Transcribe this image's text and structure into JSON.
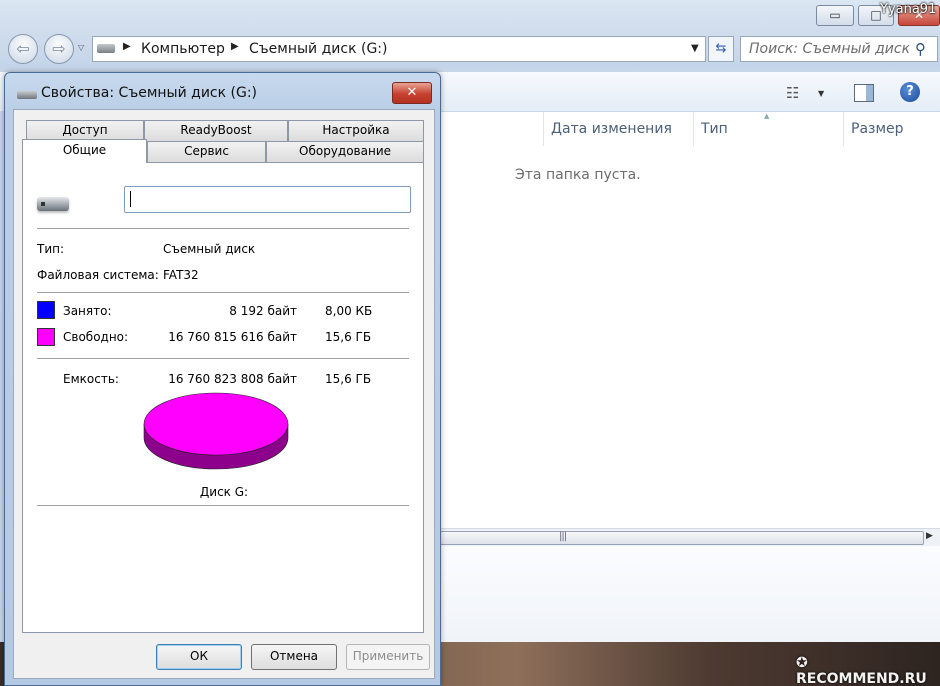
{
  "window": {
    "user_label": "Yyana91",
    "minimize_glyph": "▭",
    "maximize_glyph": "□",
    "close_glyph": "✕"
  },
  "nav": {
    "back_icon": "back-arrow-icon",
    "forward_icon": "forward-arrow-icon",
    "back_glyph": "⇦",
    "forward_glyph": "⇨",
    "recent_glyph": "▽"
  },
  "address_bar": {
    "crumbs": [
      "Компьютер",
      "Съемный диск (G:)"
    ],
    "arrow_glyph": "▶",
    "dropdown_glyph": "▼"
  },
  "refresh": {
    "glyph": "⇆"
  },
  "search": {
    "placeholder": "Поиск: Съемный диск ...",
    "icon_glyph": "⚲"
  },
  "toolbar": {
    "view_glyph": "☷",
    "dropdown_glyph": "▼",
    "help_glyph": "?"
  },
  "content": {
    "columns": [
      "Дата изменения",
      "Тип",
      "Размер"
    ],
    "sort_glyph": "▲",
    "empty_message": "Эта папка пуста."
  },
  "scrollbar": {
    "grip_glyph": "|||",
    "right_glyph": "▶"
  },
  "watermark": "✪ RECOMMEND.RU",
  "dialog": {
    "title": "Свойства: Съемный диск (G:)",
    "close_glyph": "✕",
    "tabs": {
      "access": "Доступ",
      "readyboost": "ReadyBoost",
      "settings": "Настройка",
      "general": "Общие",
      "service": "Сервис",
      "hardware": "Оборудование"
    },
    "drive_name_value": "",
    "type_label": "Тип:",
    "type_value": "Съемный диск",
    "fs_label": "Файловая система:",
    "fs_value": "FAT32",
    "used": {
      "label": "Занято:",
      "bytes": "8 192 байт",
      "size": "8,00 КБ",
      "color": "#0000ff"
    },
    "free": {
      "label": "Свободно:",
      "bytes": "16 760 815 616 байт",
      "size": "15,6 ГБ",
      "color": "#ff00ff"
    },
    "capacity": {
      "label": "Емкость:",
      "bytes": "16 760 823 808 байт",
      "size": "15,6 ГБ"
    },
    "disk_label": "Диск G:",
    "buttons": {
      "ok": "ОК",
      "cancel": "Отмена",
      "apply": "Применить"
    }
  },
  "chart_data": {
    "type": "pie",
    "categories": [
      "Занято:",
      "Свободно:"
    ],
    "values": [
      8192,
      16760815616
    ],
    "colors": [
      "#0000ff",
      "#ff00ff"
    ],
    "title": "Диск G:"
  }
}
